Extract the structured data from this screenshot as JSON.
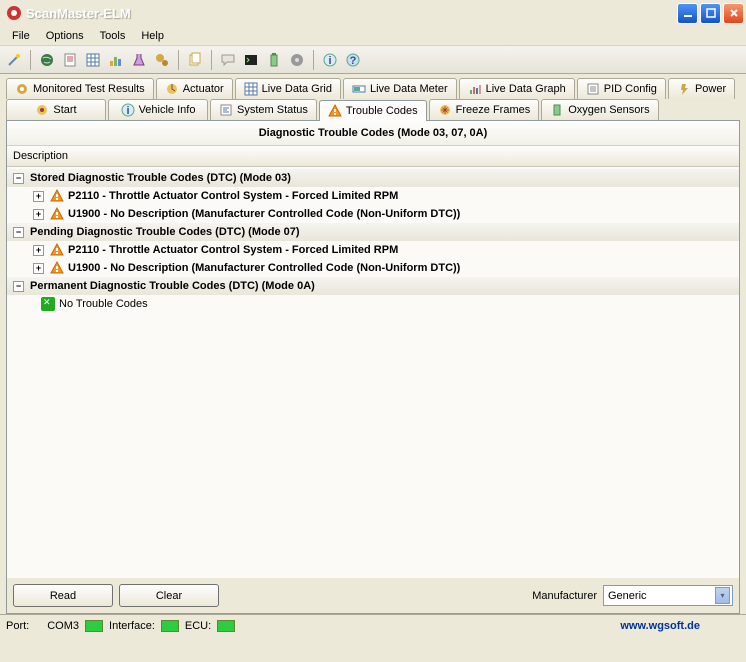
{
  "window": {
    "title": "ScanMaster-ELM"
  },
  "menu": [
    "File",
    "Options",
    "Tools",
    "Help"
  ],
  "tabs_row1": [
    {
      "label": "Monitored Test Results",
      "icon": "gear"
    },
    {
      "label": "Actuator",
      "icon": "actuator"
    },
    {
      "label": "Live Data Grid",
      "icon": "grid"
    },
    {
      "label": "Live Data Meter",
      "icon": "meter"
    },
    {
      "label": "Live Data Graph",
      "icon": "graph"
    },
    {
      "label": "PID Config",
      "icon": "config"
    },
    {
      "label": "Power",
      "icon": "power"
    }
  ],
  "tabs_row2": [
    {
      "label": "Start",
      "icon": "start"
    },
    {
      "label": "Vehicle Info",
      "icon": "info"
    },
    {
      "label": "System Status",
      "icon": "status"
    },
    {
      "label": "Trouble Codes",
      "icon": "warn",
      "active": true
    },
    {
      "label": "Freeze Frames",
      "icon": "freeze"
    },
    {
      "label": "Oxygen Sensors",
      "icon": "oxygen"
    }
  ],
  "panel": {
    "title": "Diagnostic Trouble Codes (Mode 03, 07, 0A)",
    "column": "Description"
  },
  "tree": [
    {
      "type": "group",
      "expanded": true,
      "label": "Stored Diagnostic Trouble Codes (DTC) (Mode 03)",
      "children": [
        {
          "type": "code",
          "icon": "warn",
          "label": "P2110 - Throttle Actuator Control System - Forced Limited RPM"
        },
        {
          "type": "code",
          "icon": "warn",
          "label": "U1900 - No Description (Manufacturer Controlled Code (Non-Uniform DTC))"
        }
      ]
    },
    {
      "type": "group",
      "expanded": true,
      "label": "Pending Diagnostic Trouble Codes (DTC) (Mode 07)",
      "children": [
        {
          "type": "code",
          "icon": "warn",
          "label": "P2110 - Throttle Actuator Control System - Forced Limited RPM"
        },
        {
          "type": "code",
          "icon": "warn",
          "label": "U1900 - No Description (Manufacturer Controlled Code (Non-Uniform DTC))"
        }
      ]
    },
    {
      "type": "group",
      "expanded": true,
      "label": "Permanent Diagnostic Trouble Codes (DTC) (Mode 0A)",
      "children": [
        {
          "type": "leaf",
          "icon": "ok",
          "label": "No Trouble Codes"
        }
      ]
    }
  ],
  "buttons": {
    "read": "Read",
    "clear": "Clear"
  },
  "manufacturer": {
    "label": "Manufacturer",
    "value": "Generic"
  },
  "status": {
    "port_label": "Port:",
    "port": "COM3",
    "iface_label": "Interface:",
    "ecu_label": "ECU:",
    "url": "www.wgsoft.de"
  }
}
